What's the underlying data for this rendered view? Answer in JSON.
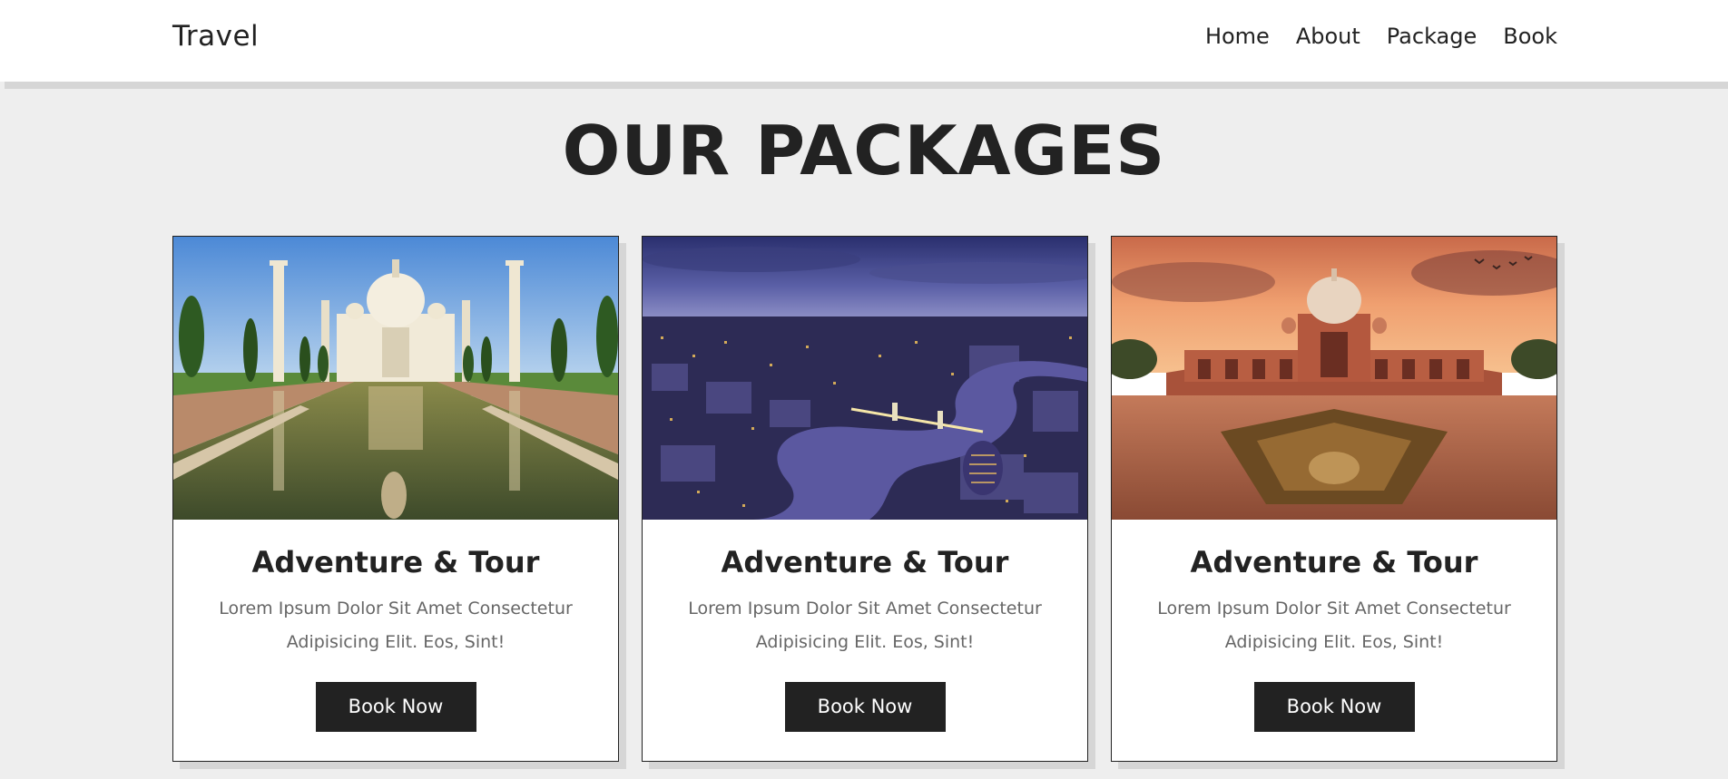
{
  "header": {
    "logo": "Travel",
    "nav": [
      "Home",
      "About",
      "Package",
      "Book"
    ]
  },
  "packages": {
    "heading": "OUR PACKAGES",
    "cards": [
      {
        "image": "taj-mahal-photo",
        "title": "Adventure & Tour",
        "text": "Lorem Ipsum Dolor Sit Amet Consectetur Adipisicing Elit. Eos, Sint!",
        "button": "Book Now"
      },
      {
        "image": "london-night-city-photo",
        "title": "Adventure & Tour",
        "text": "Lorem Ipsum Dolor Sit Amet Consectetur Adipisicing Elit. Eos, Sint!",
        "button": "Book Now"
      },
      {
        "image": "humayun-tomb-sunset-photo",
        "title": "Adventure & Tour",
        "text": "Lorem Ipsum Dolor Sit Amet Consectetur Adipisicing Elit. Eos, Sint!",
        "button": "Book Now"
      }
    ]
  },
  "colors": {
    "background": "#eeeeee",
    "dark": "#222222",
    "muted_text": "#666666",
    "shadow": "#d6d6d6"
  }
}
